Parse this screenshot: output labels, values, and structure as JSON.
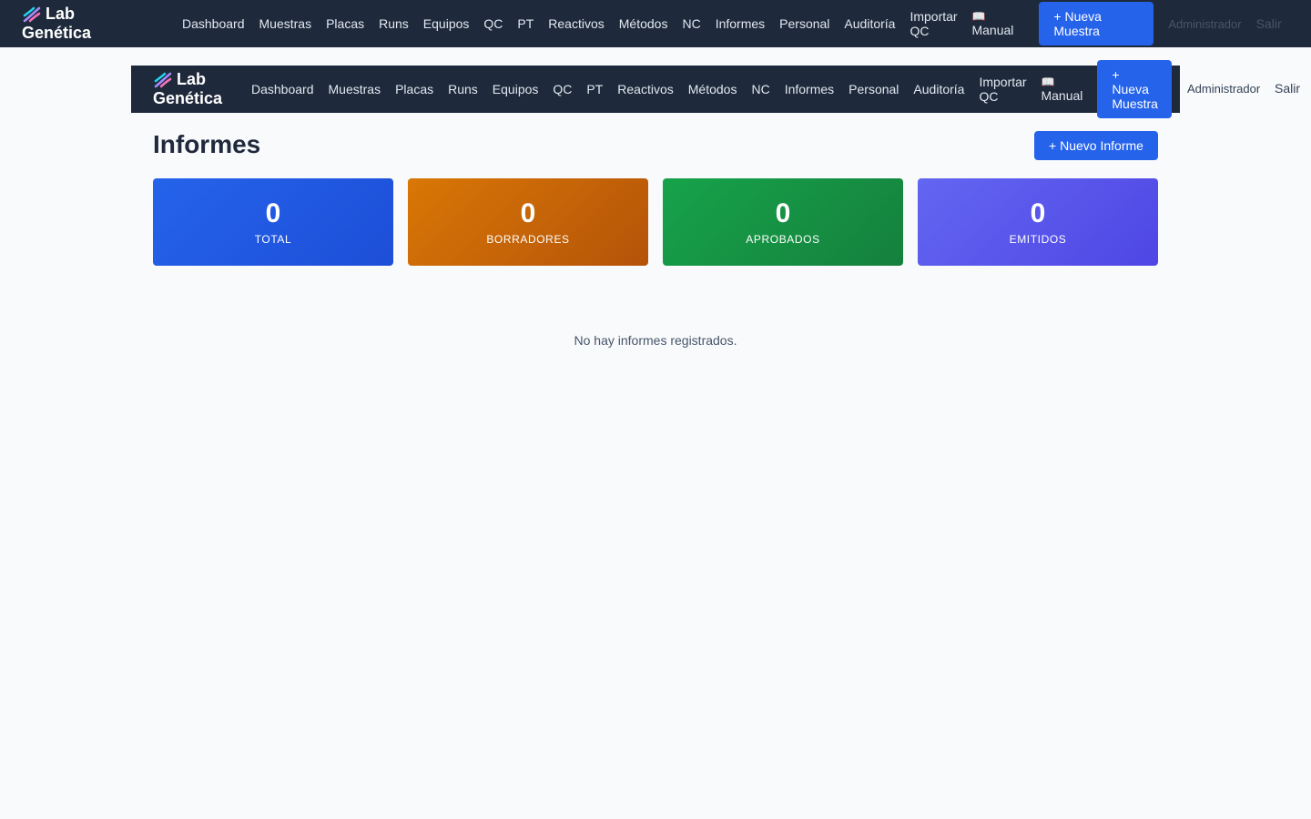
{
  "brand": {
    "line1": "Lab",
    "line2": "Genética"
  },
  "nav": {
    "items": [
      "Dashboard",
      "Muestras",
      "Placas",
      "Runs",
      "Equipos",
      "QC",
      "PT",
      "Reactivos",
      "Métodos",
      "NC",
      "Informes",
      "Personal",
      "Auditoría"
    ],
    "import_qc": {
      "line1": "Importar",
      "line2": "QC"
    },
    "manual": {
      "icon": "📖",
      "label": "Manual"
    },
    "new_sample_outer": {
      "line1": "+ Nueva",
      "line2": "Muestra"
    },
    "new_sample_inner": {
      "line1": "+",
      "line2": "Nueva",
      "line3": "Muestra"
    },
    "user": "Administrador",
    "logout": "Salir"
  },
  "page": {
    "title": "Informes",
    "new_report_label": "+ Nuevo Informe",
    "empty_message": "No hay informes registrados."
  },
  "stats": [
    {
      "value": "0",
      "label": "TOTAL",
      "color": "#2563eb"
    },
    {
      "value": "0",
      "label": "BORRADORES",
      "color": "#d97706"
    },
    {
      "value": "0",
      "label": "APROBADOS",
      "color": "#16a34a"
    },
    {
      "value": "0",
      "label": "EMITIDOS",
      "color": "#6366f1"
    }
  ],
  "icons": {
    "brand": "dna-icon",
    "manual": "book-icon"
  }
}
